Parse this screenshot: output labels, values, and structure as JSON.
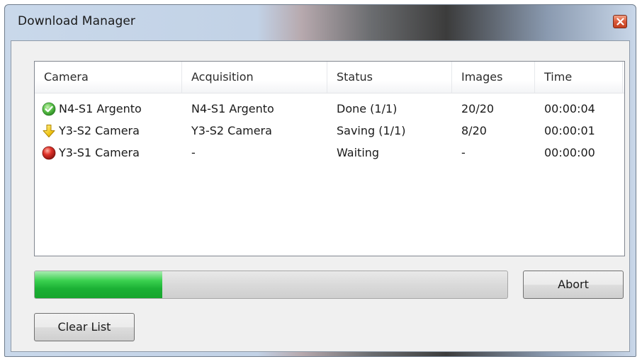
{
  "window": {
    "title": "Download Manager"
  },
  "list": {
    "columns": [
      "Camera",
      "Acquisition",
      "Status",
      "Images",
      "Time"
    ],
    "rows": [
      {
        "icon": "check-icon",
        "camera": "N4-S1 Argento",
        "acquisition": "N4-S1 Argento",
        "status": "Done (1/1)",
        "images": "20/20",
        "time": "00:00:04"
      },
      {
        "icon": "download-arrow-icon",
        "camera": "Y3-S2 Camera",
        "acquisition": "Y3-S2 Camera",
        "status": "Saving (1/1)",
        "images": "8/20",
        "time": "00:00:01"
      },
      {
        "icon": "red-dot-icon",
        "camera": "Y3-S1 Camera",
        "acquisition": "-",
        "status": "Waiting",
        "images": "-",
        "time": "00:00:00"
      }
    ]
  },
  "progress": {
    "value": 0.27,
    "fill_color": "#1bb034"
  },
  "buttons": {
    "abort": "Abort",
    "clear_list": "Clear List"
  },
  "colors": {
    "close_button": "#d9593a",
    "progress_green": "#1bb034"
  }
}
